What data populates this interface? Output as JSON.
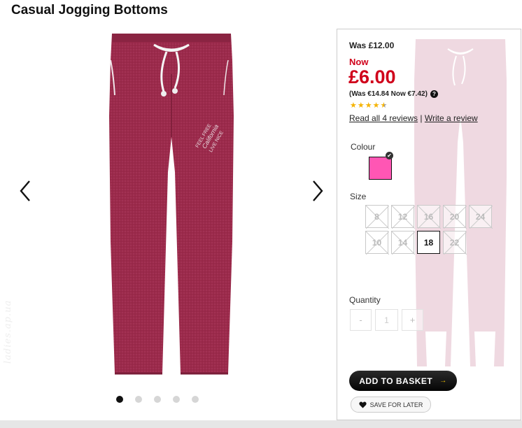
{
  "product": {
    "title": "Casual Jogging Bottoms"
  },
  "gallery": {
    "image_alt": "Burgundy jogging bottoms",
    "dots": 5,
    "active_dot": 0,
    "prev_icon": "chevron-left-icon",
    "next_icon": "chevron-right-icon",
    "watermark": "ladies.ap.ua"
  },
  "pricing": {
    "was": "Was £12.00",
    "now_label": "Now",
    "now_price": "£6.00",
    "euro": "(Was €14.84 Now €7.42)",
    "help_icon": "?",
    "rating": 4.5,
    "rating_max": 5,
    "read_reviews": "Read all 4 reviews",
    "separator": "|",
    "write_review": "Write a review"
  },
  "colour": {
    "label": "Colour",
    "selected": "#ff56b4"
  },
  "size": {
    "label": "Size",
    "options": [
      "8",
      "12",
      "16",
      "20",
      "24",
      "10",
      "14",
      "18",
      "22"
    ],
    "selected": "18"
  },
  "quantity": {
    "label": "Quantity",
    "minus": "-",
    "value": "1",
    "plus": "+"
  },
  "actions": {
    "add_to_basket": "ADD TO BASKET",
    "add_arrow": "→",
    "save_for_later": "SAVE FOR LATER"
  },
  "colors": {
    "price_red": "#d0021b",
    "garment": "#9b2a4b",
    "swatch_pink": "#ff56b4"
  }
}
